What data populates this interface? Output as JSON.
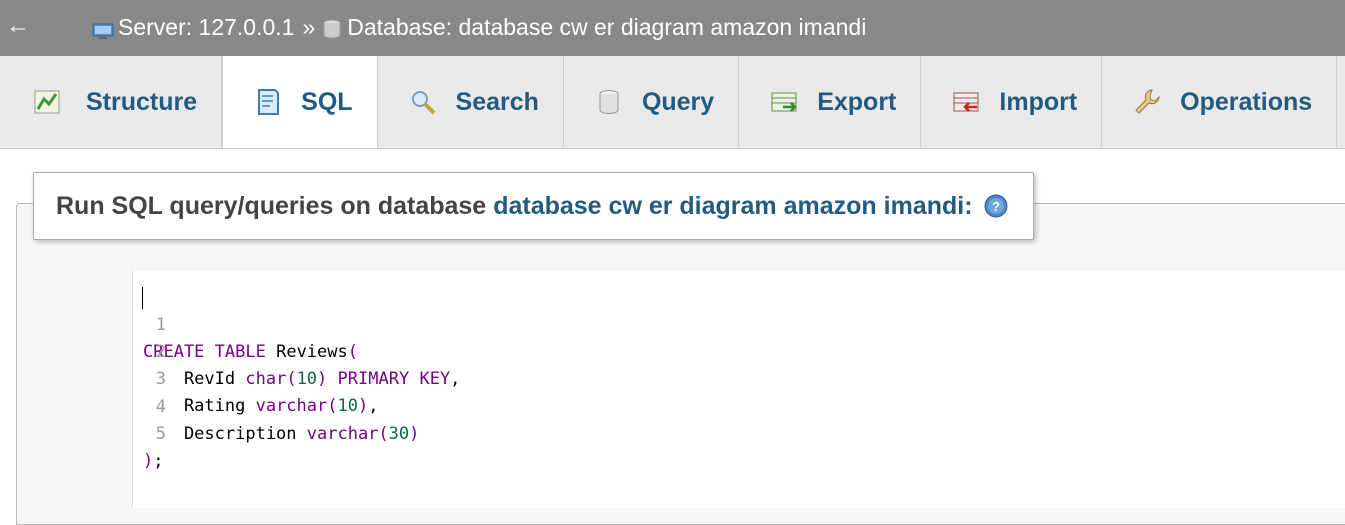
{
  "breadcrumb": {
    "server": "Server: 127.0.0.1",
    "separator": "»",
    "database": "Database: database cw er diagram amazon imandi"
  },
  "tabs": [
    {
      "label": "Structure",
      "icon": "structure-icon",
      "active": false
    },
    {
      "label": "SQL",
      "icon": "sql-icon",
      "active": true
    },
    {
      "label": "Search",
      "icon": "search-icon",
      "active": false
    },
    {
      "label": "Query",
      "icon": "query-icon",
      "active": false
    },
    {
      "label": "Export",
      "icon": "export-icon",
      "active": false
    },
    {
      "label": "Import",
      "icon": "import-icon",
      "active": false
    },
    {
      "label": "Operations",
      "icon": "wrench-icon",
      "active": false
    }
  ],
  "panel": {
    "title_prefix": "Run SQL query/queries on database",
    "title_db": "database cw er diagram amazon imandi:",
    "help_icon": "help-icon"
  },
  "editor": {
    "lines": [
      {
        "number": "1",
        "text": "CREATE TABLE Reviews("
      },
      {
        "number": "2",
        "text": "    RevId char(10) PRIMARY KEY,"
      },
      {
        "number": "3",
        "text": "    Rating varchar(10),"
      },
      {
        "number": "4",
        "text": "    Description varchar(30)"
      },
      {
        "number": "5",
        "text": ");"
      }
    ]
  },
  "colors": {
    "topbar": "#888888",
    "link": "#235a81",
    "keyword": "#770088",
    "number": "#116644"
  }
}
